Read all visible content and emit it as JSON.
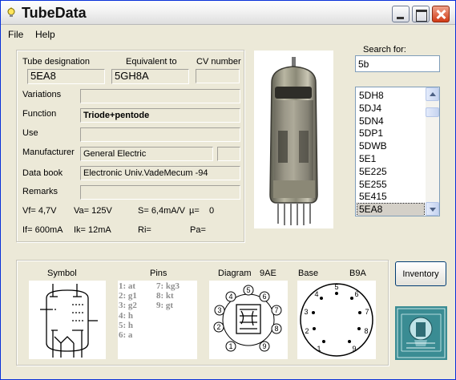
{
  "window": {
    "title": "TubeData"
  },
  "menu": {
    "file": "File",
    "help": "Help"
  },
  "details": {
    "designation_label": "Tube designation",
    "designation_value": "5EA8",
    "equivalent_label": "Equivalent to",
    "equivalent_value": "5GH8A",
    "cv_label": "CV number",
    "cv_value": "",
    "variations_label": "Variations",
    "variations_value": "",
    "function_label": "Function",
    "function_value": "Triode+pentode",
    "use_label": "Use",
    "use_value": "",
    "manufacturer_label": "Manufacturer",
    "manufacturer_value": "General Electric",
    "manufacturer_extra": "",
    "databook_label": "Data book",
    "databook_value": "Electronic Univ.VadeMecum -94",
    "remarks_label": "Remarks",
    "remarks_value": ""
  },
  "ratings": {
    "vf": "Vf= 4,7V",
    "va": "Va= 125V",
    "s": "S= 6,4mA/V",
    "mu": "µ=",
    "mu_value": "0",
    "if": "If= 600mA",
    "ik": "Ik= 12mA",
    "ri": "Ri=",
    "pa": "Pa="
  },
  "search": {
    "label": "Search for:",
    "value": "5b",
    "results": [
      "5DH8",
      "5DJ4",
      "5DN4",
      "5DP1",
      "5DWB",
      "5E1",
      "5E225",
      "5E255",
      "5E415",
      "5EA8"
    ],
    "selected": "5EA8"
  },
  "bottom": {
    "symbol_label": "Symbol",
    "pins_label": "Pins",
    "diagram_label": "Diagram",
    "diagram_code": "9AE",
    "base_label": "Base",
    "base_code": "B9A",
    "pins": [
      {
        "num": "1:",
        "name": "at"
      },
      {
        "num": "2:",
        "name": "g1"
      },
      {
        "num": "3:",
        "name": "g2"
      },
      {
        "num": "4:",
        "name": "h"
      },
      {
        "num": "5:",
        "name": "h"
      },
      {
        "num": "6:",
        "name": "a"
      },
      {
        "num": "7:",
        "name": "kg3"
      },
      {
        "num": "8:",
        "name": "kt"
      },
      {
        "num": "9:",
        "name": "gt"
      }
    ],
    "inventory_button": "Inventory"
  },
  "icons": [
    "bulb-icon",
    "minimize-icon",
    "maximize-icon",
    "close-icon",
    "scroll-up-icon",
    "scroll-down-icon",
    "tube-logo-icon"
  ],
  "colors": {
    "titlebar": "#efefef",
    "window_face": "#ece9d8",
    "close_button": "#d13a15",
    "list_selection": "#d4d0c8",
    "pins_text": "#8e8e8e",
    "logo_bg": "#3a8c93"
  }
}
